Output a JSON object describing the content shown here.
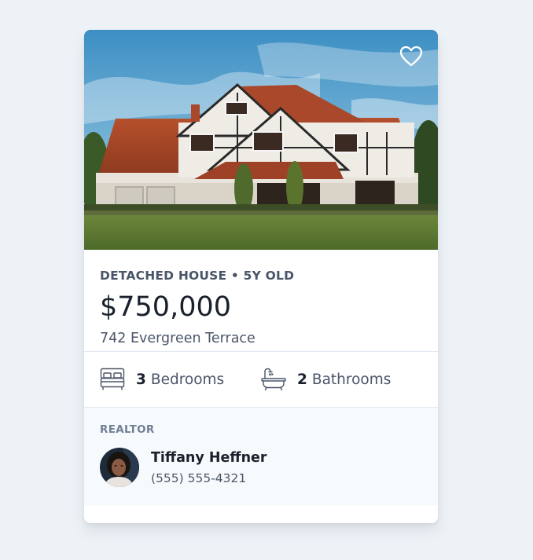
{
  "listing": {
    "property_type": "Detached house",
    "age": "5y old",
    "price": "$750,000",
    "address": "742 Evergreen Terrace",
    "photo_icon": "house-photo"
  },
  "favorite": {
    "icon": "heart-icon",
    "favorited": false
  },
  "features": {
    "bedrooms": {
      "count": "3",
      "label": "Bedrooms",
      "icon": "bed-icon"
    },
    "bathrooms": {
      "count": "2",
      "label": "Bathrooms",
      "icon": "bathtub-icon"
    }
  },
  "realtor": {
    "label": "Realtor",
    "name": "Tiffany Heffner",
    "phone": "(555) 555-4321",
    "avatar_icon": "avatar"
  },
  "colors": {
    "page_background": "#edf2f7",
    "card_background": "#ffffff",
    "footer_background": "#f7fafc",
    "text_dark": "#1a202c",
    "text_muted": "#4a5568",
    "text_label": "#718096",
    "divider": "#e2e8f0"
  }
}
